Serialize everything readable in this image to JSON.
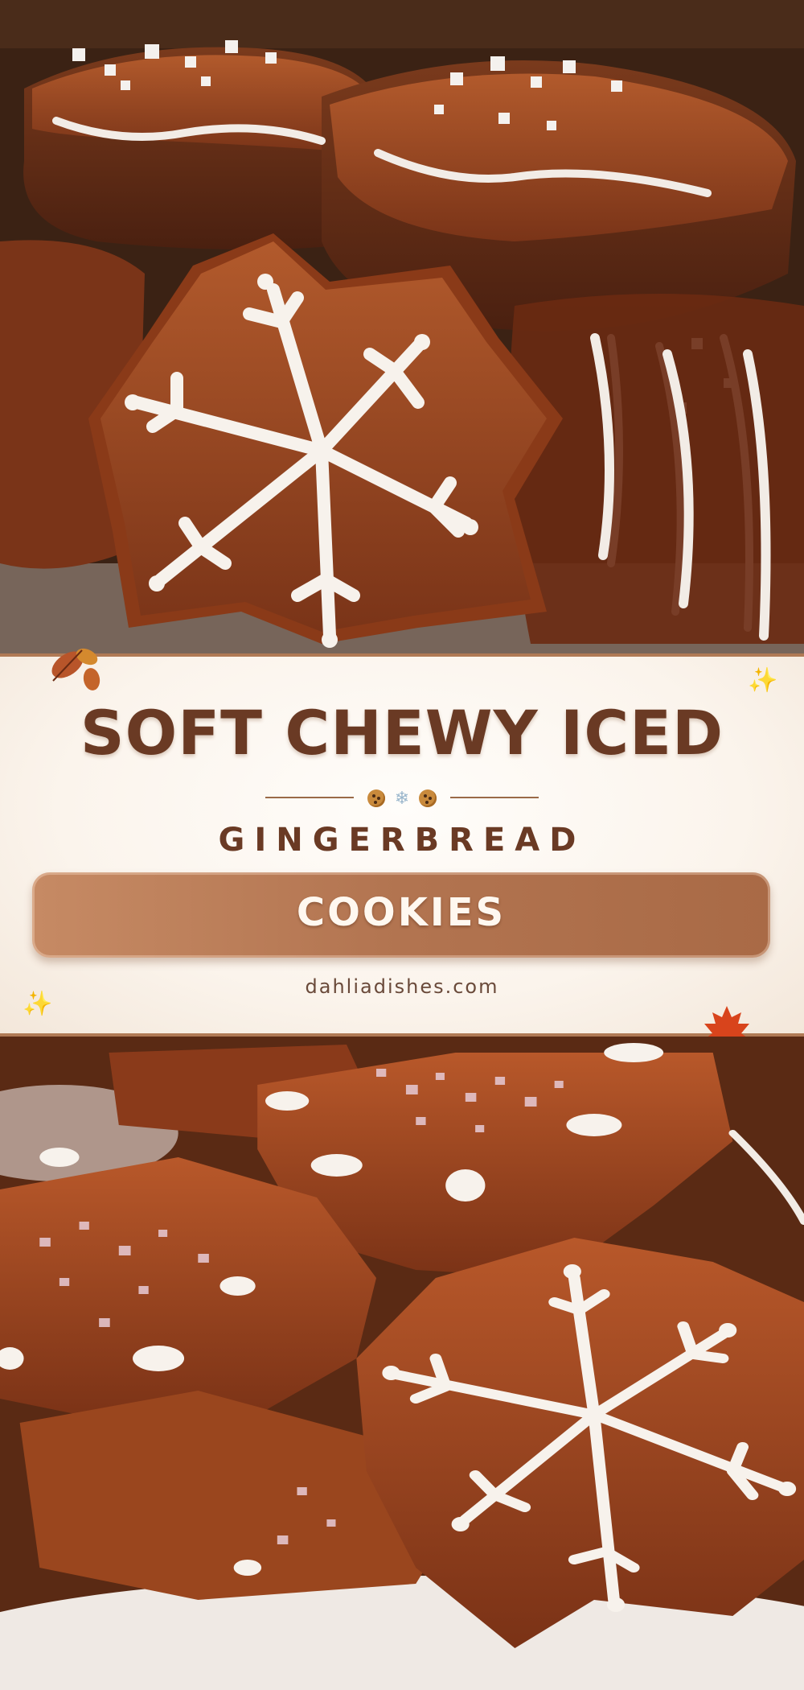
{
  "title": {
    "line1": "SOFT CHEWY ICED",
    "line2": "GINGERBREAD",
    "badge": "COOKIES"
  },
  "website": "dahliadishes.com",
  "divider_icons": [
    "cookie-icon",
    "snowflake-icon",
    "cookie-icon"
  ],
  "decor_icons": [
    "autumn-leaves-icon",
    "sparkle-icon",
    "maple-leaf-icon"
  ],
  "colors": {
    "title": "#6a3a24",
    "badge_bg": "#b27450",
    "badge_text": "#fff8f0",
    "band_bg": "#fbf4ec",
    "accent_border": "#b07a55"
  },
  "photos": {
    "top": "glazed-star-gingerbread-cookies-with-snowflake-icing",
    "bottom": "sugared-star-gingerbread-cookies-on-doily"
  }
}
